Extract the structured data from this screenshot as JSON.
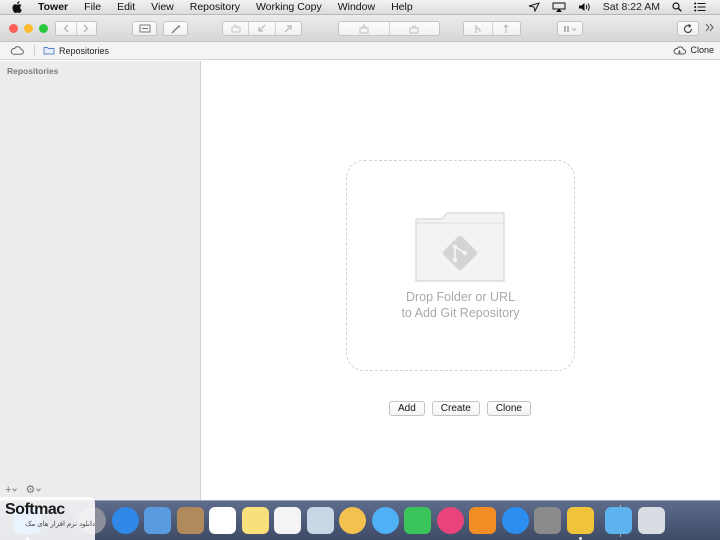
{
  "menubar": {
    "app_name": "Tower",
    "items": [
      "File",
      "Edit",
      "View",
      "Repository",
      "Working Copy",
      "Window",
      "Help"
    ],
    "clock": "Sat 8:22 AM"
  },
  "pathbar": {
    "repositories_label": "Repositories",
    "clone_label": "Clone"
  },
  "sidebar": {
    "heading": "Repositories",
    "add_symbol": "+",
    "settings_symbol": "⚙"
  },
  "main": {
    "drop_line1": "Drop Folder or URL",
    "drop_line2": "to Add Git Repository",
    "buttons": {
      "add": "Add",
      "create": "Create",
      "clone": "Clone"
    }
  },
  "watermark": {
    "brand": "Softmac",
    "tagline": "دانلود نرم افزار های مک"
  },
  "colors": {
    "close": "#fc5f57",
    "minimize": "#fdbc2e",
    "zoom": "#28c840",
    "placeholder_gray": "#a9a9a9",
    "dock_bg": "#4a5674"
  },
  "dock_apps": [
    {
      "name": "finder-icon",
      "color": "#4ea7f2"
    },
    {
      "name": "siri-icon",
      "color": "#3a3a6e"
    },
    {
      "name": "launchpad-icon",
      "color": "#8a8f9a"
    },
    {
      "name": "safari-icon",
      "color": "#2f87e6"
    },
    {
      "name": "mail-icon",
      "color": "#5a9be0"
    },
    {
      "name": "contacts-icon",
      "color": "#b08a5b"
    },
    {
      "name": "calendar-icon",
      "color": "#ffffff"
    },
    {
      "name": "notes-icon",
      "color": "#f8e17a"
    },
    {
      "name": "reminders-icon",
      "color": "#f4f4f4"
    },
    {
      "name": "preview-icon",
      "color": "#c9d6e6"
    },
    {
      "name": "photos-icon",
      "color": "#f2c14e"
    },
    {
      "name": "messages-icon",
      "color": "#4fb0f5"
    },
    {
      "name": "facetime-icon",
      "color": "#3bc45a"
    },
    {
      "name": "itunes-icon",
      "color": "#e8447b"
    },
    {
      "name": "ibooks-icon",
      "color": "#f28c24"
    },
    {
      "name": "app-store-icon",
      "color": "#2c8ef0"
    },
    {
      "name": "system-preferences-icon",
      "color": "#8b8b8b"
    },
    {
      "name": "tower-icon",
      "color": "#f0c43a"
    },
    {
      "name": "downloads-folder-icon",
      "color": "#5db3ee"
    },
    {
      "name": "trash-icon",
      "color": "#d9dde3"
    }
  ]
}
